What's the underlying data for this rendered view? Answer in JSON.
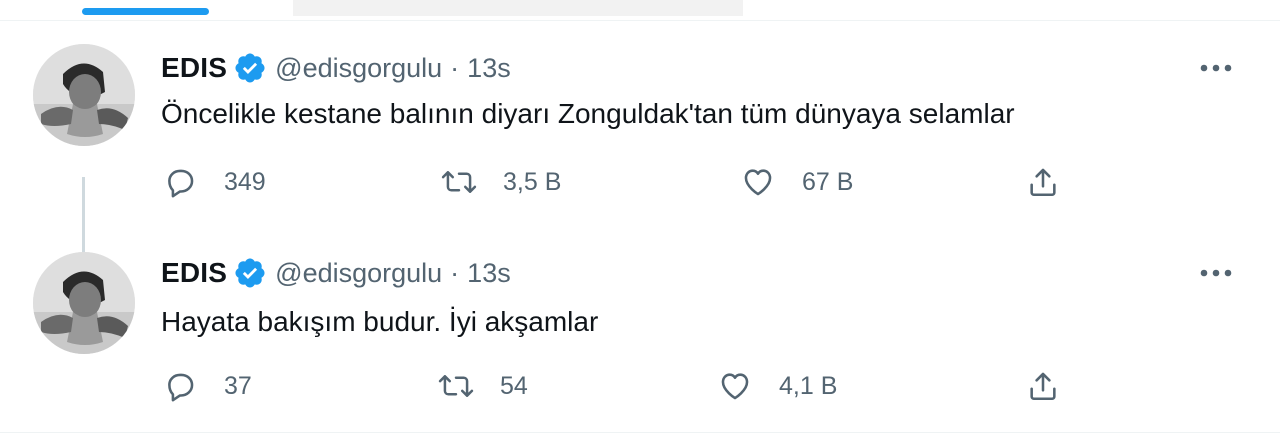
{
  "tweets": [
    {
      "name": "EDIS",
      "handle": "@edisgorgulu",
      "separator": "·",
      "time": "13s",
      "text": "Öncelikle kestane balının diyarı Zonguldak'tan tüm dünyaya selamlar",
      "replies": "349",
      "retweets": "3,5 B",
      "likes": "67 B"
    },
    {
      "name": "EDIS",
      "handle": "@edisgorgulu",
      "separator": "·",
      "time": "13s",
      "text": "Hayata bakışım budur. İyi akşamlar",
      "replies": "37",
      "retweets": "54",
      "likes": "4,1 B"
    }
  ],
  "icons": {
    "verified": "verified-badge-icon",
    "more": "more-dots-icon",
    "reply": "reply-icon",
    "retweet": "retweet-icon",
    "like": "like-heart-icon",
    "share": "share-icon"
  },
  "colors": {
    "accent": "#1d9bf0",
    "text": "#0f1419",
    "secondary": "#536471",
    "thread_line": "#cfd9de"
  }
}
